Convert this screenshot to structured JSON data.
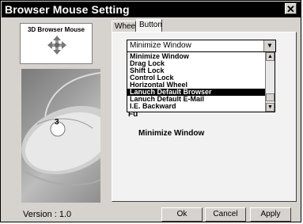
{
  "window": {
    "title": "Browser Mouse Setting",
    "close_glyph": "✕"
  },
  "left": {
    "logo_label": "3D Browser Mouse",
    "logo_icon": "four-way-arrows-icon",
    "photo_badge": "3",
    "version": "Version : 1.0"
  },
  "tabs": [
    {
      "label": "Wheel"
    },
    {
      "label": "Button"
    }
  ],
  "button_tab": {
    "combo_value": "Minimize Window",
    "options": [
      "Minimize Window",
      "Drag Lock",
      "Shift Lock",
      "Control Lock",
      "Horizontal Wheel",
      "Lanuch Default Browser",
      "Lanuch Default E-Mail",
      "I.E. Backward"
    ],
    "selected_option": "Lanuch Default Browser",
    "function_label_visible": "Fu",
    "function_value": "Minimize Window"
  },
  "buttons": {
    "ok": "Ok",
    "cancel": "Cancel",
    "apply": "Apply"
  },
  "colors": {
    "title_bg": "#000000",
    "dialog_bg": "#d6d3ce",
    "selection_bg": "#000000"
  }
}
